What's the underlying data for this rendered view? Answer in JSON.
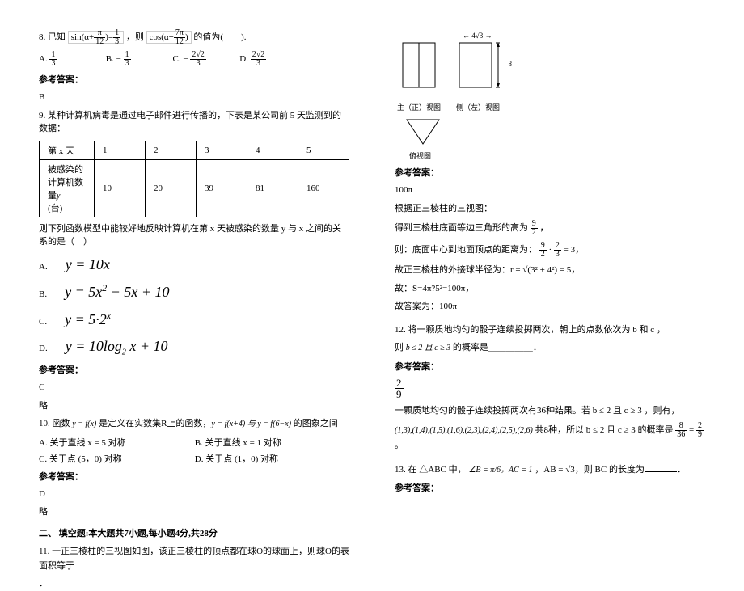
{
  "q8": {
    "intro_pre": "8. 已知 ",
    "eq1_num": "sin(α + π/12) = 1/3",
    "intro_mid": "，则 ",
    "eq2": "cos(α + 7π/12)",
    "intro_suf": " 的值为(　　).",
    "opt_a_label": "A. ",
    "opt_a_val_num": "1",
    "opt_a_val_den": "3",
    "opt_b_label": "B. ",
    "opt_b_sign": "−",
    "opt_b_val_num": "1",
    "opt_b_val_den": "3",
    "opt_c_label": "C. ",
    "opt_c_sign": "−",
    "opt_c_val_num": "2√2",
    "opt_c_val_den": "3",
    "opt_d_label": "D. ",
    "opt_d_val_num": "2√2",
    "opt_d_val_den": "3",
    "ans_label": "参考答案：",
    "ans": "B"
  },
  "q9": {
    "stem": "9. 某种计算机病毒是通过电子邮件进行传播的，下表是某公司前 5 天监测到的数据：",
    "table": {
      "h1": "第 x 天",
      "c1": "1",
      "c2": "2",
      "c3": "3",
      "c4": "4",
      "c5": "5",
      "h2pre": "被感染的计算机数量",
      "h2suf": "(台)",
      "v1": "10",
      "v2": "20",
      "v3": "39",
      "v4": "81",
      "v5": "160"
    },
    "stem2": "则下列函数模型中能较好地反映计算机在第 x 天被感染的数量 y 与 x 之间的关系的是（　）",
    "opt_a_p": "A.",
    "opt_a": "y = 10x",
    "opt_b_p": "B.",
    "opt_b": "y = 5x² − 5x + 10",
    "opt_c_p": "C.",
    "opt_c": "y = 5·2ˣ",
    "opt_d_p": "D.",
    "opt_d": "y = 10log₂ x + 10",
    "ans_label": "参考答案：",
    "ans": "C",
    "note": "略"
  },
  "q10": {
    "stem_pre": "10. 函数 ",
    "fn": "y = f(x)",
    "stem_mid": " 是定义在实数集R上的函数，",
    "cond": "y = f(x+4) 与 y = f(6−x)",
    "stem_suf": " 的图象之间",
    "opt_a": "A. 关于直线 x = 5 对称",
    "opt_b": "B. 关于直线 x = 1 对称",
    "opt_c": "C. 关于点 (5，0) 对称",
    "opt_d": "D. 关于点 (1，0) 对称",
    "ans_label": "参考答案：",
    "ans": "D",
    "note": "略"
  },
  "section2": "二、 填空题:本大题共7小题,每小题4分,共28分",
  "q11": {
    "stem_a": "11. 一正三棱柱的三视图如图，该正三棱柱的顶点都在球O的球面上，则球O的表面积等于",
    "stem_b": "．",
    "dim1": "4√3",
    "dim2": "8",
    "label_front": "主（正）视图",
    "label_side": "侧（左）视图",
    "label_top": "俯视图",
    "ans_label": "参考答案：",
    "ans": "100π",
    "s1": "根据正三棱柱的三视图：",
    "s2_pre": "得到三棱柱底面等边三角形的高为 ",
    "s2_frac_num": "9",
    "s2_frac_den": "2",
    "s2_suf": "，",
    "s3_pre": "则：底面中心到地面顶点的距离为：",
    "s3_a_num": "9",
    "s3_a_den": "2",
    "s3_dot": "·",
    "s3_b_num": "2",
    "s3_b_den": "3",
    "s3_eq": " = 3，",
    "s4": "故正三棱柱的外接球半径为：r = √(3² + 4²) = 5，",
    "s5": "故：S=4π?5²=100π，",
    "s6": "故答案为：100π"
  },
  "q12": {
    "stem1": "12. 将一颗质地均匀的骰子连续投掷两次，朝上的点数依次为 b 和 c ，",
    "stem2_pre": "则 ",
    "stem2_cond": "b ≤ 2 且 c ≥ 3",
    "stem2_suf": " 的概率是＿＿＿＿＿．",
    "ans_label": "参考答案：",
    "ans_num": "2",
    "ans_den": "9",
    "sol1": "一颗质地均匀的骰子连续投掷两次有36种结果。若 b ≤ 2 且 c ≥ 3 ，则有，",
    "sol2_list": "(1,3),(1,4),(1,5),(1,6),(2,3),(2,4),(2,5),(2,6)",
    "sol2_suf": "共8种，所以 b ≤ 2 且 c ≥ 3 的概率是 ",
    "sol2_rhs_num": "8",
    "sol2_rhs_den": "36",
    "sol2_eq": " = ",
    "sol2_r2n": "2",
    "sol2_r2d": "9",
    "sol2_dot": "。"
  },
  "q13": {
    "stem_pre": "13. 在 △ABC 中，",
    "angle": "∠B = π/6，AC = 1",
    "mid": "，AB = √3，则 BC 的长度为",
    "suf": "．",
    "ans_label": "参考答案："
  }
}
